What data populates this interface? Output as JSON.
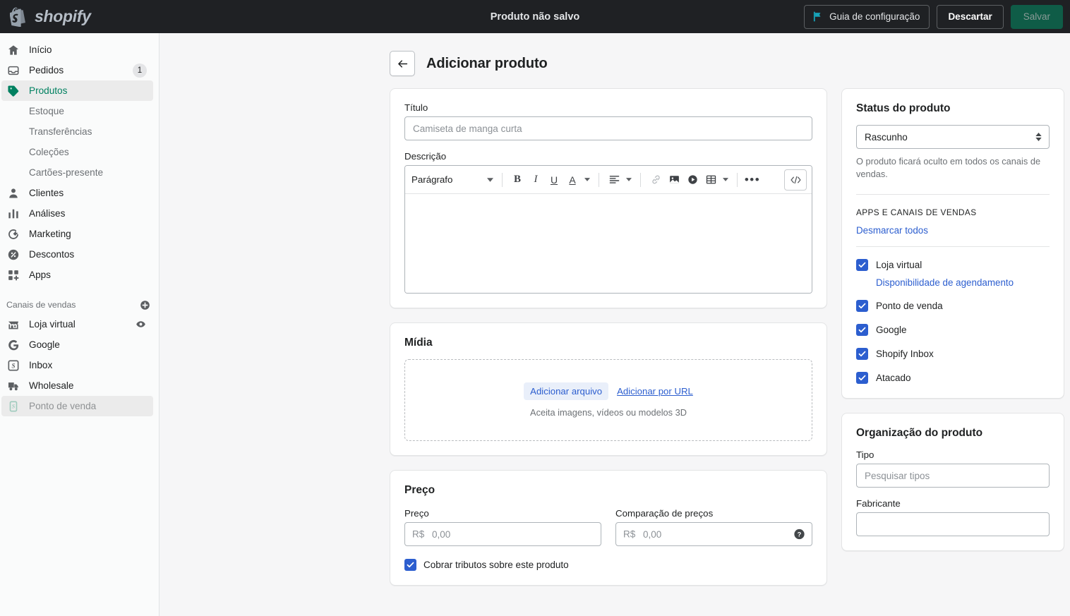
{
  "topbar": {
    "logo_text": "shopify",
    "title": "Produto não salvo",
    "guide_button": "Guia de configuração",
    "discard_button": "Descartar",
    "save_button": "Salvar",
    "flag_icon": "flag-icon"
  },
  "sidebar": {
    "items": [
      {
        "label": "Início",
        "icon": "home-icon",
        "badge": ""
      },
      {
        "label": "Pedidos",
        "icon": "orders-inbox-icon",
        "badge": "1"
      },
      {
        "label": "Produtos",
        "icon": "tag-icon",
        "badge": ""
      }
    ],
    "product_subitems": [
      {
        "label": "Estoque"
      },
      {
        "label": "Transferências"
      },
      {
        "label": "Coleções"
      },
      {
        "label": "Cartões-presente"
      }
    ],
    "items_after": [
      {
        "label": "Clientes",
        "icon": "customer-icon"
      },
      {
        "label": "Análises",
        "icon": "analytics-bars-icon"
      },
      {
        "label": "Marketing",
        "icon": "marketing-icon"
      },
      {
        "label": "Descontos",
        "icon": "discount-icon"
      },
      {
        "label": "Apps",
        "icon": "apps-grid-icon"
      }
    ],
    "channels_header": "Canais de vendas",
    "channels_add_icon": "plus-circle-icon",
    "channels": [
      {
        "label": "Loja virtual",
        "icon": "storefront-icon",
        "trailing_icon": "eye-icon"
      },
      {
        "label": "Google",
        "icon": "google-g-icon",
        "trailing_icon": ""
      },
      {
        "label": "Inbox",
        "icon": "inbox-s-icon",
        "trailing_icon": ""
      },
      {
        "label": "Wholesale",
        "icon": "wholesale-truck-icon",
        "trailing_icon": ""
      },
      {
        "label": "Ponto de venda",
        "icon": "pos-icon",
        "trailing_icon": ""
      }
    ]
  },
  "page": {
    "back_icon": "arrow-left-icon",
    "title": "Adicionar produto"
  },
  "product_card": {
    "title_label": "Título",
    "title_placeholder": "Camiseta de manga curta",
    "title_value": "",
    "description_label": "Descrição",
    "description_value": "",
    "toolbar": {
      "paragraph_style": "Parágrafo",
      "bold": "B",
      "italic": "I",
      "underline": "U",
      "text_color": "A",
      "align_icon": "align-left-icon",
      "link_icon": "link-icon",
      "image_icon": "image-icon",
      "video_icon": "video-play-icon",
      "table_icon": "table-icon",
      "more_icon": "more-horizontal-icon",
      "code_icon": "code-brackets-icon"
    }
  },
  "media_card": {
    "title": "Mídia",
    "add_file_button": "Adicionar arquivo",
    "add_url_link": "Adicionar por URL",
    "hint": "Aceita imagens, vídeos ou modelos 3D"
  },
  "price_card": {
    "title": "Preço",
    "price_label": "Preço",
    "price_prefix": "R$",
    "price_placeholder": "0,00",
    "price_value": "",
    "compare_label": "Comparação de preços",
    "compare_prefix": "R$",
    "compare_placeholder": "0,00",
    "compare_value": "",
    "help_icon": "question-mark-circle-icon",
    "tax_checkbox_label": "Cobrar tributos sobre este produto",
    "tax_checked": true
  },
  "status_card": {
    "title": "Status do produto",
    "status_value": "Rascunho",
    "status_help": "O produto ficará oculto em todos os canais de vendas.",
    "channels_caption": "APPS E CANAIS DE VENDAS",
    "uncheck_all_link": "Desmarcar todos",
    "channels": [
      {
        "label": "Loja virtual",
        "checked": true,
        "sublink": "Disponibilidade de agendamento"
      },
      {
        "label": "Ponto de venda",
        "checked": true,
        "sublink": ""
      },
      {
        "label": "Google",
        "checked": true,
        "sublink": ""
      },
      {
        "label": "Shopify Inbox",
        "checked": true,
        "sublink": ""
      },
      {
        "label": "Atacado",
        "checked": true,
        "sublink": ""
      }
    ]
  },
  "organization_card": {
    "title": "Organização do produto",
    "type_label": "Tipo",
    "type_placeholder": "Pesquisar tipos",
    "type_value": "",
    "vendor_label": "Fabricante",
    "vendor_placeholder": "",
    "vendor_value": ""
  },
  "colors": {
    "topbar_bg": "#1f2124",
    "accent_green": "#008060",
    "save_green": "#0f5c47",
    "link_blue": "#2c5ecf",
    "checkbox_blue": "#2c5ecf",
    "flag_teal": "#17a3b8",
    "page_bg": "#f6f6f7"
  }
}
